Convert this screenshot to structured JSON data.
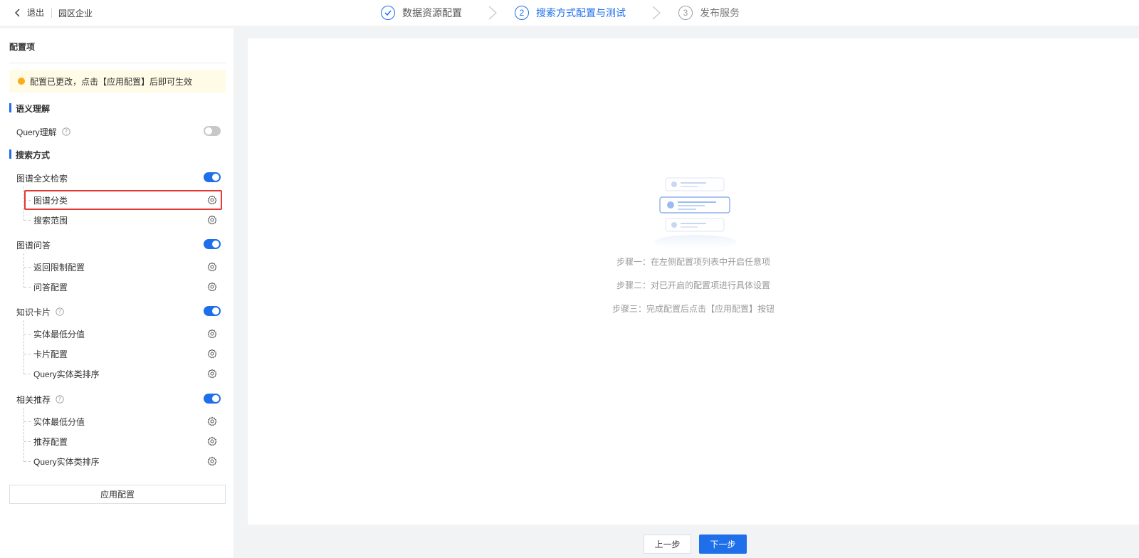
{
  "topbar": {
    "back_label": "退出",
    "project_name": "园区企业",
    "steps": [
      {
        "index": "✓",
        "label": "数据资源配置",
        "state": "done"
      },
      {
        "index": "2",
        "label": "搜索方式配置与测试",
        "state": "active"
      },
      {
        "index": "3",
        "label": "发布服务",
        "state": "todo"
      }
    ]
  },
  "sidebar": {
    "title": "配置项",
    "notice": "配置已更改，点击【应用配置】后即可生效",
    "sections": {
      "semantic": "语义理解",
      "search": "搜索方式"
    },
    "query_understanding": {
      "label": "Query理解",
      "enabled": false
    },
    "graph_fulltext": {
      "label": "图谱全文检索",
      "enabled": true,
      "items": [
        "图谱分类",
        "搜索范围"
      ]
    },
    "graph_qa": {
      "label": "图谱问答",
      "enabled": true,
      "items": [
        "返回限制配置",
        "问答配置"
      ]
    },
    "knowledge_card": {
      "label": "知识卡片",
      "enabled": true,
      "items": [
        "实体最低分值",
        "卡片配置",
        "Query实体类排序"
      ]
    },
    "related_recommend": {
      "label": "相关推荐",
      "enabled": true,
      "items": [
        "实体最低分值",
        "推荐配置",
        "Query实体类排序"
      ]
    },
    "apply_label": "应用配置"
  },
  "main": {
    "hints": [
      "步骤一：在左侧配置项列表中开启任意项",
      "步骤二：对已开启的配置项进行具体设置",
      "步骤三：完成配置后点击【应用配置】按钮"
    ]
  },
  "footer": {
    "prev_label": "上一步",
    "next_label": "下一步"
  },
  "colors": {
    "accent": "#1f6feb",
    "warning": "#faad14",
    "highlight": "#e53935"
  }
}
